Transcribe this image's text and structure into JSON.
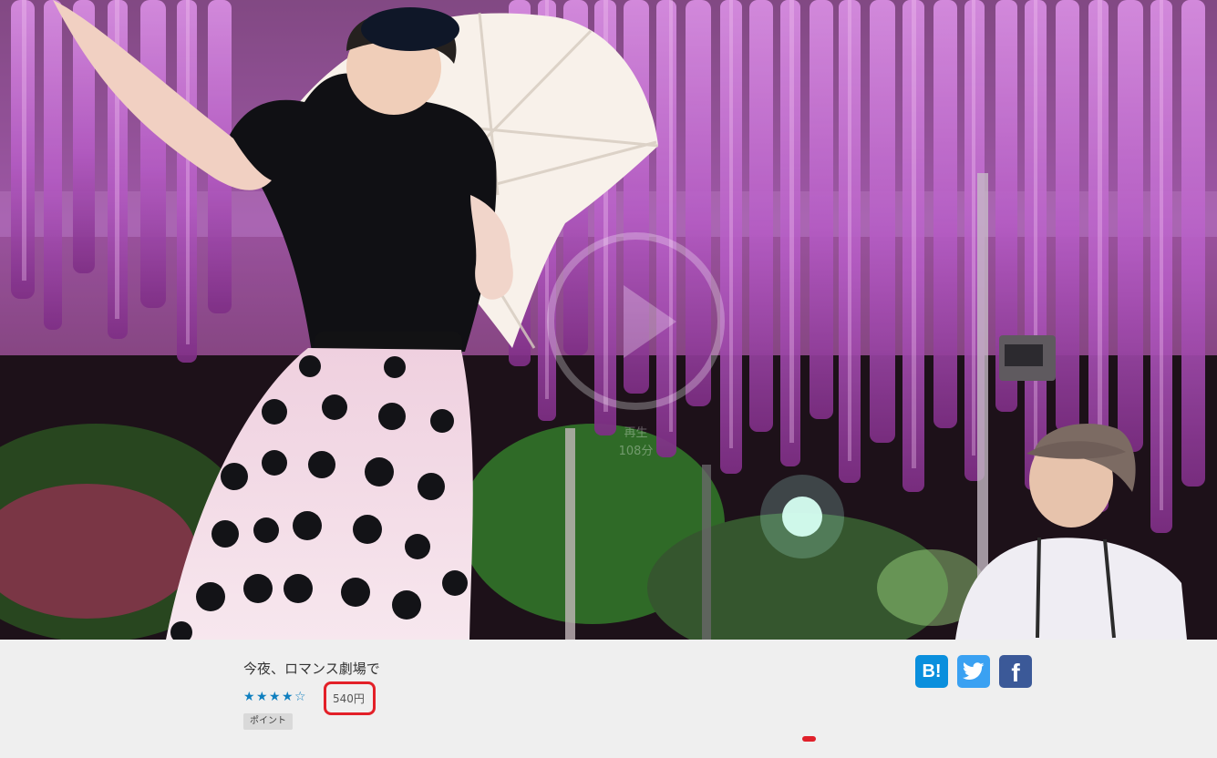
{
  "hero": {
    "alt": "Woman in polka-dot dress holding a parasol under glowing wisteria at night, with a man in a cap seated in the lower right",
    "play_label_line1": "再生",
    "play_label_line2": "108分"
  },
  "movie": {
    "title": "今夜、ロマンス劇場で",
    "rating_stars": [
      "★",
      "★",
      "★",
      "★",
      "☆"
    ],
    "rating_value": 4,
    "rating_max": 5,
    "price": "540円",
    "points_badge": "ポイント"
  },
  "share": {
    "hatena_label": "B!",
    "facebook_label": "f"
  },
  "colors": {
    "rating_star": "#0f7fbf",
    "price_highlight_border": "#e32028",
    "hatena": "#0a8fdd",
    "twitter": "#3aa1f2",
    "facebook": "#3b5998",
    "info_background": "#efefef"
  },
  "icons": {
    "play": "play-circle-icon",
    "hatena": "hatena-bookmark-icon",
    "twitter": "twitter-bird-icon",
    "facebook": "facebook-f-icon"
  }
}
